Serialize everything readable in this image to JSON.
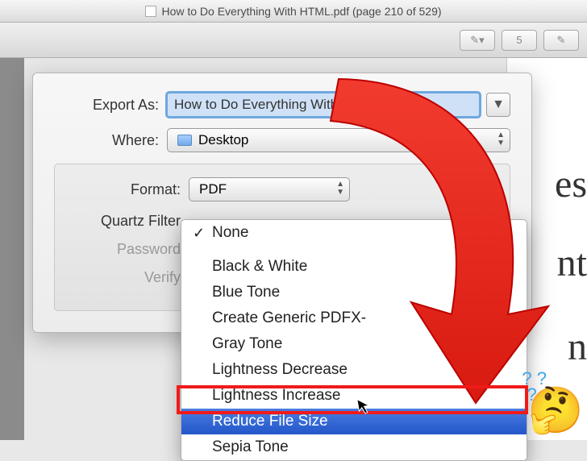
{
  "window": {
    "title": "How to Do Everything With HTML.pdf (page 210 of 529)"
  },
  "export": {
    "label": "Export As:",
    "value": "How to Do Everything With HTML"
  },
  "where": {
    "label": "Where:",
    "value": "Desktop"
  },
  "format": {
    "label": "Format:",
    "value": "PDF"
  },
  "quartz": {
    "label": "Quartz Filter",
    "selected": "None",
    "options": {
      "o0": "None",
      "o1": "Black & White",
      "o2": "Blue Tone",
      "o3": "Create Generic PDFX-",
      "o4": "Gray Tone",
      "o5": "Lightness Decrease",
      "o6": "Lightness Increase",
      "o7": "Reduce File Size",
      "o8": "Sepia Tone"
    }
  },
  "password": {
    "label": "Password"
  },
  "verify": {
    "label": "Verify"
  },
  "ghost": {
    "g1": "es",
    "g2": "nt",
    "g3": "n"
  }
}
